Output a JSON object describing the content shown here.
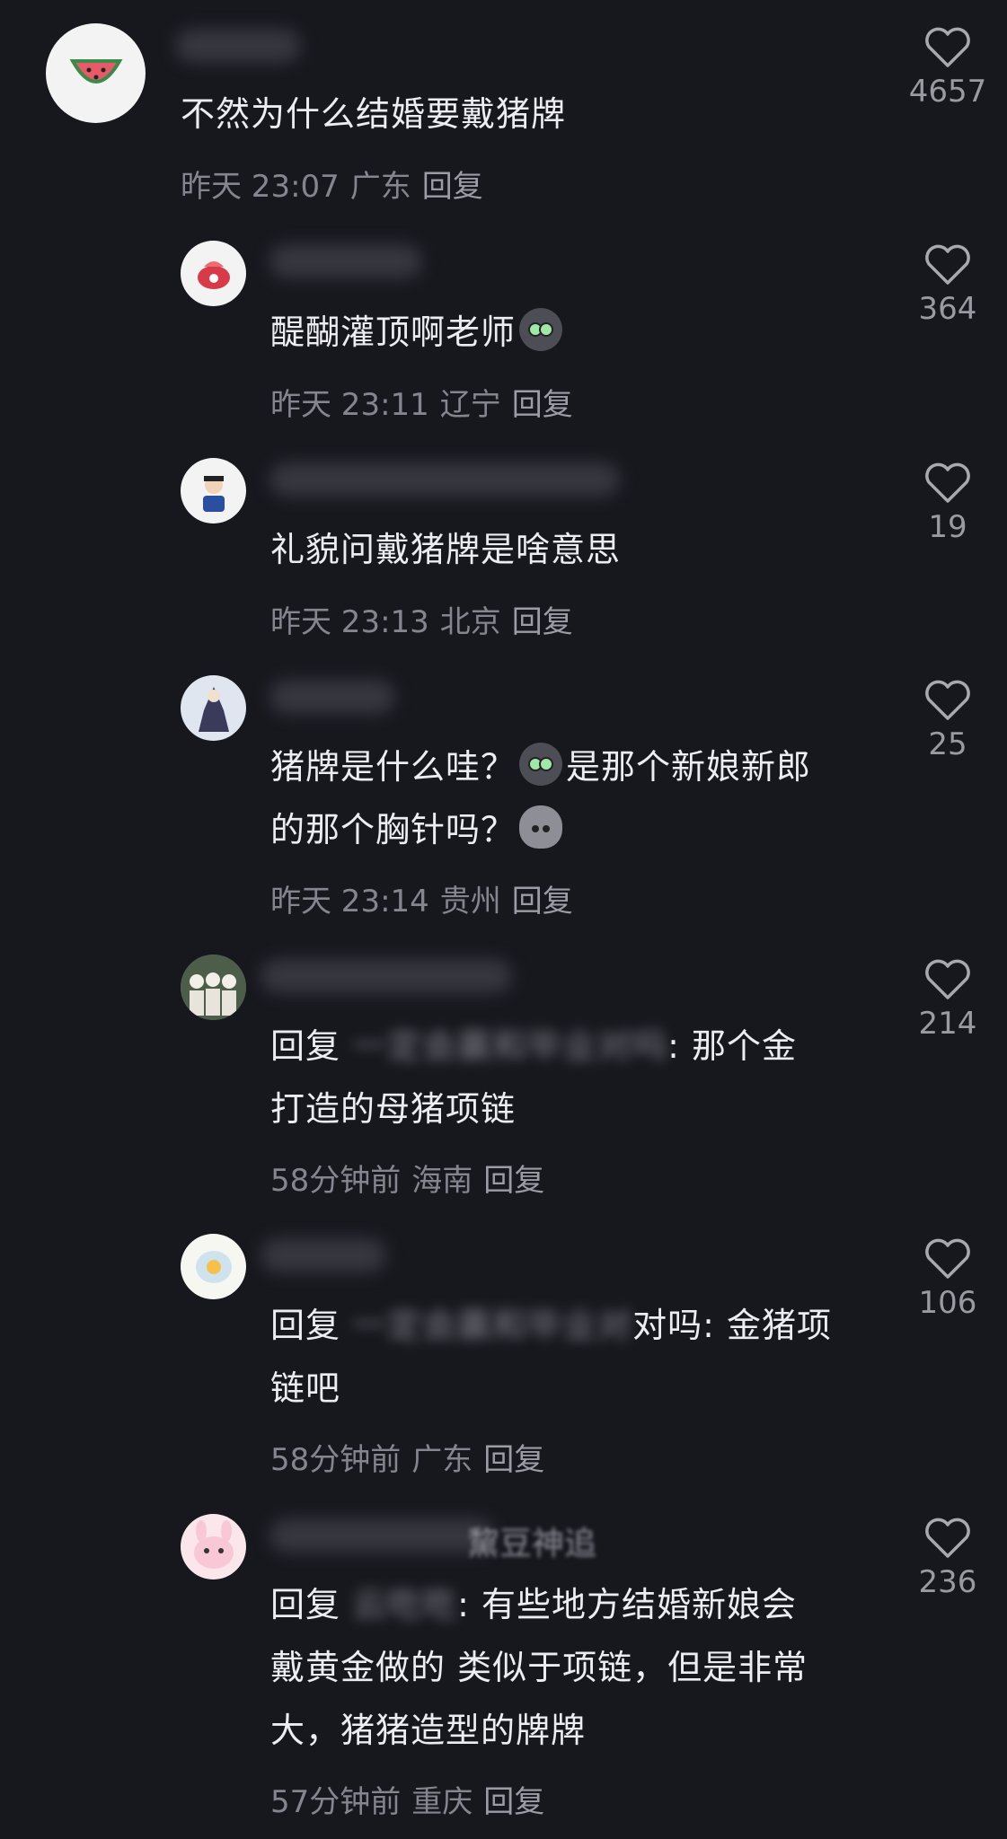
{
  "comments": [
    {
      "text_lines": [
        "不然为什么结婚要戴猪牌"
      ],
      "time": "昨天 23:07",
      "location": "广东",
      "reply": "回复",
      "likes": "4657",
      "avatar_icon": "watermelon-icon"
    },
    {
      "text_lines": [
        "醍醐灌顶啊老师"
      ],
      "time": "昨天 23:11",
      "location": "辽宁",
      "reply": "回复",
      "likes": "364",
      "avatar_icon": "strawberry-cake-icon"
    },
    {
      "text_lines": [
        "礼貌问戴猪牌是啥意思"
      ],
      "time": "昨天 23:13",
      "location": "北京",
      "reply": "回复",
      "likes": "19",
      "avatar_icon": "cartoon-person-icon"
    },
    {
      "line1_a": "猪牌是什么哇？",
      "line1_b": "是那个新娘新郎",
      "line2": "的那个胸针吗？",
      "time": "昨天 23:14",
      "location": "贵州",
      "reply": "回复",
      "likes": "25",
      "avatar_icon": "anime-figure-icon"
    },
    {
      "prefix": "回复",
      "blurred": "一定会赢和毕业对吗",
      "line1_tail": ": 那个金",
      "line2": "打造的母猪项链",
      "time": "58分钟前",
      "location": "海南",
      "reply": "回复",
      "likes": "214",
      "avatar_icon": "group-photo-icon"
    },
    {
      "prefix": "回复",
      "blurred": "一定会赢和毕业对",
      "line1_tail": "对吗: 金猪项",
      "line2": "链吧",
      "time": "58分钟前",
      "location": "广东",
      "reply": "回复",
      "likes": "106",
      "avatar_icon": "egg-icon"
    },
    {
      "prefix": "回复",
      "blurred": "云吃吃",
      "line1_tail": ": 有些地方结婚新娘会",
      "line2": "戴黄金做的 类似于项链，但是非常",
      "line3": "大，猪猪造型的牌牌",
      "time": "57分钟前",
      "location": "重庆",
      "reply": "回复",
      "likes": "236",
      "avatar_icon": "pink-bunny-icon",
      "name_partial": "黧豆神追"
    }
  ]
}
